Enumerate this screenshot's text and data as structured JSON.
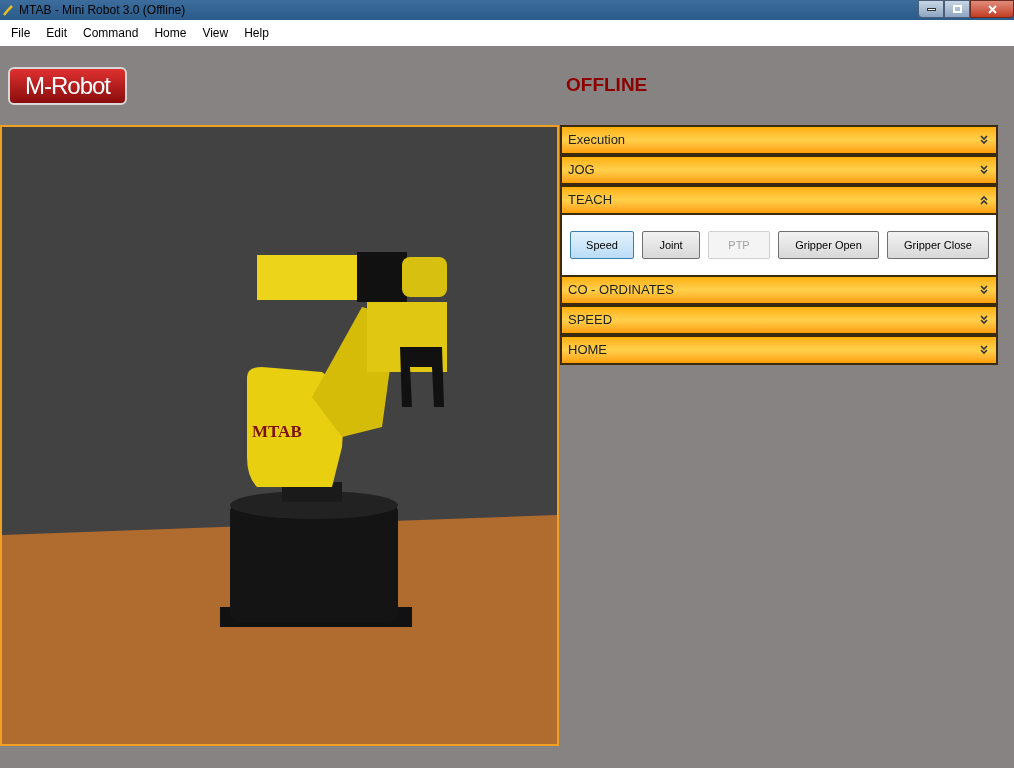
{
  "window": {
    "title": "MTAB - Mini Robot 3.0 (Offline)"
  },
  "menu": [
    "File",
    "Edit",
    "Command",
    "Home",
    "View",
    "Help"
  ],
  "logo": "M-Robot",
  "status": "OFFLINE",
  "viewport": {
    "robot_label": "MTAB"
  },
  "panels": [
    {
      "title": "Execution",
      "expanded": false
    },
    {
      "title": "JOG",
      "expanded": false
    },
    {
      "title": "TEACH",
      "expanded": true,
      "buttons": [
        {
          "label": "Speed",
          "selected": true,
          "disabled": false
        },
        {
          "label": "Joint",
          "selected": false,
          "disabled": false
        },
        {
          "label": "PTP",
          "selected": false,
          "disabled": true
        },
        {
          "label": "Gripper Open",
          "selected": false,
          "disabled": false
        },
        {
          "label": "Gripper Close",
          "selected": false,
          "disabled": false
        }
      ]
    },
    {
      "title": "CO - ORDINATES",
      "expanded": false
    },
    {
      "title": "SPEED",
      "expanded": false
    },
    {
      "title": "HOME",
      "expanded": false
    }
  ]
}
